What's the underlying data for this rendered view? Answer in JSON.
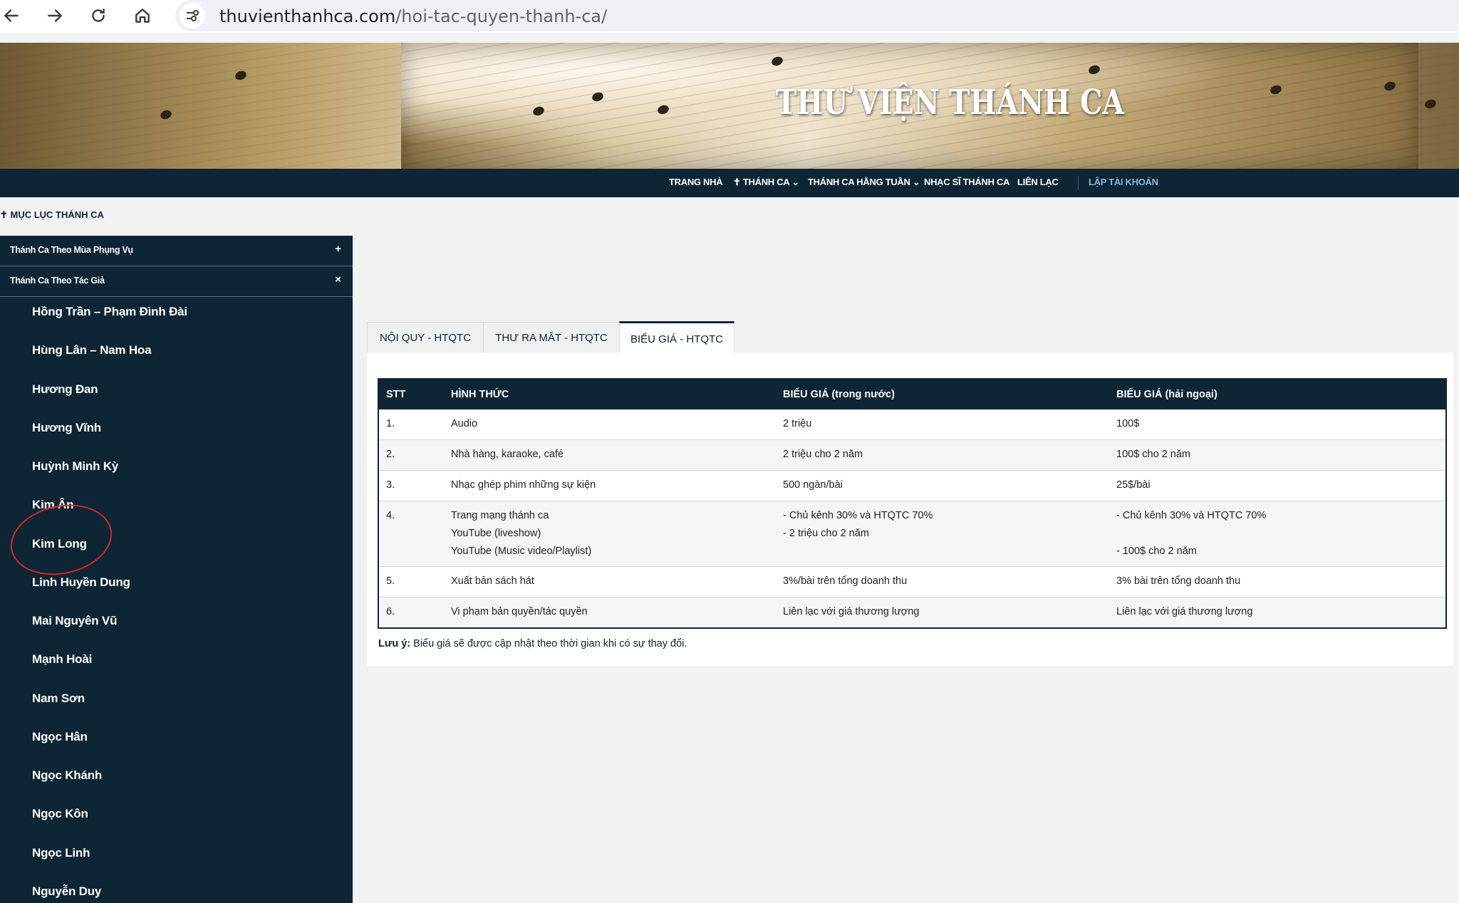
{
  "browser": {
    "url_domain": "thuvienthanhca.com",
    "url_path": "/hoi-tac-quyen-thanh-ca/"
  },
  "banner": {
    "title": "THƯ VIỆN THÁNH CA"
  },
  "nav": {
    "items": [
      "TRANG NHÀ",
      "✝ THÁNH CA ⌄",
      "THÁNH CA HẰNG TUẦN ⌄",
      "NHẠC SĨ THÁNH CA",
      "LIÊN LẠC"
    ],
    "account": "LẬP TÀI KHOẢN"
  },
  "sidebar": {
    "title": "✝ MỤC LỤC THÁNH CA",
    "sections": [
      {
        "label": "Thánh Ca Theo Mùa Phụng Vụ",
        "symbol": "+"
      },
      {
        "label": "Thánh Ca Theo Tác Giả",
        "symbol": "×"
      }
    ],
    "authors": [
      "Hồng Trần – Phạm Đình Đài",
      "Hùng Lân – Nam Hoa",
      "Hương Đan",
      "Hương Vĩnh",
      "Huỳnh Minh Kỳ",
      "Kim Ân",
      "Kim Long",
      "Linh Huyền Dung",
      "Mai Nguyên Vũ",
      "Mạnh Hoài",
      "Nam Sơn",
      "Ngọc Hân",
      "Ngọc Khánh",
      "Ngọc Kôn",
      "Ngọc Linh",
      "Nguyễn Duy"
    ]
  },
  "tabs": [
    "NỘI QUY - HTQTC",
    "THƯ RA MẮT - HTQTC",
    "BIỂU GIÁ - HTQTC"
  ],
  "table": {
    "headers": [
      "STT",
      "HÌNH THỨC",
      "BIỂU GIÁ (trong nước)",
      "BIỂU GIÁ (hải ngoại)"
    ],
    "rows": [
      {
        "stt": "1.",
        "form": [
          "Audio"
        ],
        "domestic": [
          "2 triệu"
        ],
        "overseas": [
          "100$"
        ]
      },
      {
        "stt": "2.",
        "form": [
          "Nhà hàng, karaoke, café"
        ],
        "domestic": [
          "2 triệu cho 2 năm"
        ],
        "overseas": [
          "100$ cho 2 năm"
        ]
      },
      {
        "stt": "3.",
        "form": [
          "Nhạc ghép phim những sự kiện"
        ],
        "domestic": [
          "500 ngàn/bài"
        ],
        "overseas": [
          "25$/bài"
        ]
      },
      {
        "stt": "4.",
        "form": [
          "Trang mạng thánh ca",
          "YouTube (liveshow)",
          "YouTube (Music video/Playlist)"
        ],
        "domestic": [
          "- Chủ kênh 30% và HTQTC 70%",
          "- 2 triệu cho 2 năm"
        ],
        "overseas": [
          "- Chủ kênh 30% và HTQTC 70%",
          "",
          "- 100$ cho 2 năm"
        ]
      },
      {
        "stt": "5.",
        "form": [
          "Xuất bản sách hát"
        ],
        "domestic": [
          "3%/bài trên tổng doanh thu"
        ],
        "overseas": [
          "3% bài trên tổng doanh thu"
        ]
      },
      {
        "stt": "6.",
        "form": [
          "Vi phạm bản quyền/tác quyền"
        ],
        "domestic": [
          "Liên lạc với giá thương lượng"
        ],
        "overseas": [
          "Liên lạc với giá thương lượng"
        ]
      }
    ]
  },
  "note": {
    "label": "Lưu ý:",
    "text": " Biểu giá sẽ được cập nhật theo thời gian khi có sự thay đổi."
  }
}
